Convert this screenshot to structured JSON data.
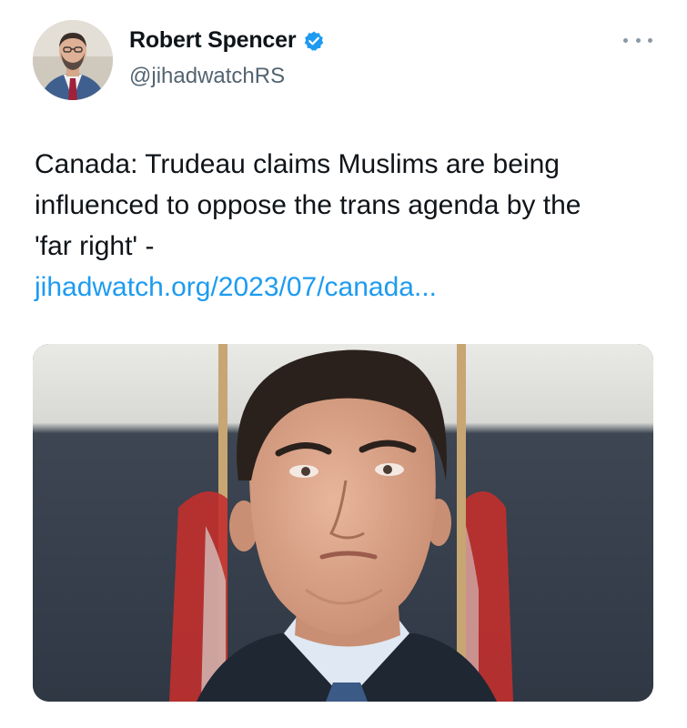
{
  "author": {
    "display_name": "Robert Spencer",
    "handle": "@jihadwatchRS",
    "verified": true,
    "verified_color": "#1d9bf0",
    "avatar_icon": "author-avatar-photo"
  },
  "more_menu_icon": "ellipsis-icon",
  "tweet": {
    "text_lines": [
      "Canada: Trudeau claims Muslims are being",
      "influenced to oppose the trans agenda by the",
      "'far right' -"
    ],
    "link": "jihadwatch.org/2023/07/canada...",
    "link_color": "#1d9bf0"
  },
  "media": {
    "type": "photo",
    "icon": "news-photo-man-portrait"
  },
  "colors": {
    "text": "#0f1419",
    "secondary": "#536471",
    "background": "#ffffff"
  }
}
